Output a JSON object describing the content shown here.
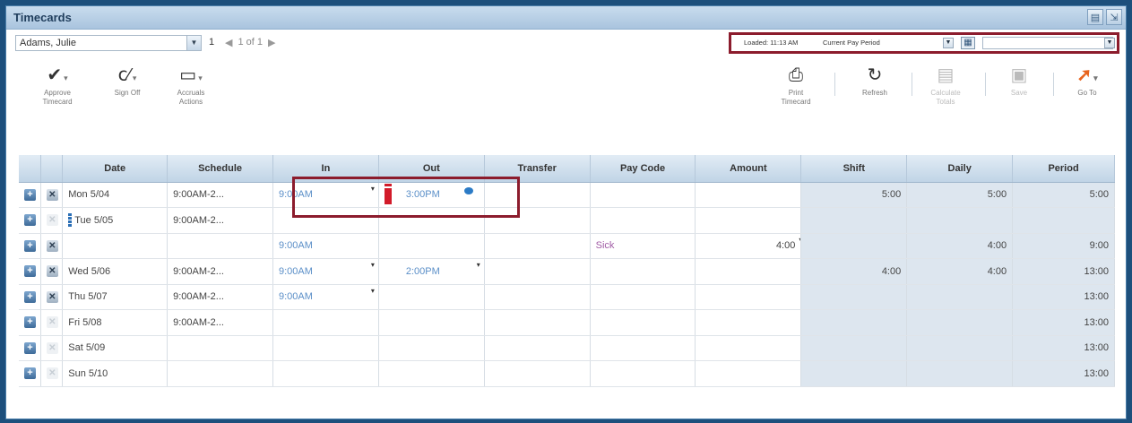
{
  "window": {
    "title": "Timecards"
  },
  "employee": {
    "name": "Adams, Julie",
    "count": "1",
    "pager": "1 of 1"
  },
  "period_bar": {
    "loaded": "Loaded: 11:13 AM",
    "period": "Current Pay Period"
  },
  "toolbar": {
    "approve": "Approve Timecard",
    "signoff": "Sign Off",
    "accruals": "Accruals Actions",
    "print": "Print Timecard",
    "refresh": "Refresh",
    "calculate": "Calculate Totals",
    "save": "Save",
    "goto": "Go To"
  },
  "columns": [
    "Date",
    "Schedule",
    "In",
    "Out",
    "Transfer",
    "Pay Code",
    "Amount",
    "Shift",
    "Daily",
    "Period"
  ],
  "rows": [
    {
      "date": "Mon 5/04",
      "schedule": "9:00AM-2...",
      "in": "9:00AM",
      "out": "3:00PM",
      "transfer": "",
      "paycode": "",
      "amount": "",
      "shift": "5:00",
      "daily": "5:00",
      "period": "5:00"
    },
    {
      "date": "Tue 5/05",
      "schedule": "9:00AM-2...",
      "in": "",
      "out": "",
      "transfer": "",
      "paycode": "",
      "amount": "",
      "shift": "",
      "daily": "",
      "period": ""
    },
    {
      "date": "",
      "schedule": "",
      "in": "9:00AM",
      "out": "",
      "transfer": "",
      "paycode": "Sick",
      "amount": "4:00",
      "shift": "",
      "daily": "4:00",
      "period": "9:00"
    },
    {
      "date": "Wed 5/06",
      "schedule": "9:00AM-2...",
      "in": "9:00AM",
      "out": "2:00PM",
      "transfer": "",
      "paycode": "",
      "amount": "",
      "shift": "4:00",
      "daily": "4:00",
      "period": "13:00"
    },
    {
      "date": "Thu 5/07",
      "schedule": "9:00AM-2...",
      "in": "9:00AM",
      "out": "",
      "transfer": "",
      "paycode": "",
      "amount": "",
      "shift": "",
      "daily": "",
      "period": "13:00"
    },
    {
      "date": "Fri 5/08",
      "schedule": "9:00AM-2...",
      "in": "",
      "out": "",
      "transfer": "",
      "paycode": "",
      "amount": "",
      "shift": "",
      "daily": "",
      "period": "13:00"
    },
    {
      "date": "Sat 5/09",
      "schedule": "",
      "in": "",
      "out": "",
      "transfer": "",
      "paycode": "",
      "amount": "",
      "shift": "",
      "daily": "",
      "period": "13:00"
    },
    {
      "date": "Sun 5/10",
      "schedule": "",
      "in": "",
      "out": "",
      "transfer": "",
      "paycode": "",
      "amount": "",
      "shift": "",
      "daily": "",
      "period": "13:00"
    }
  ],
  "colors": {
    "highlight": "#8c1c2d",
    "punch": "#5b8fc8",
    "paycode": "#a05ba5",
    "flag": "#d21b2a"
  }
}
